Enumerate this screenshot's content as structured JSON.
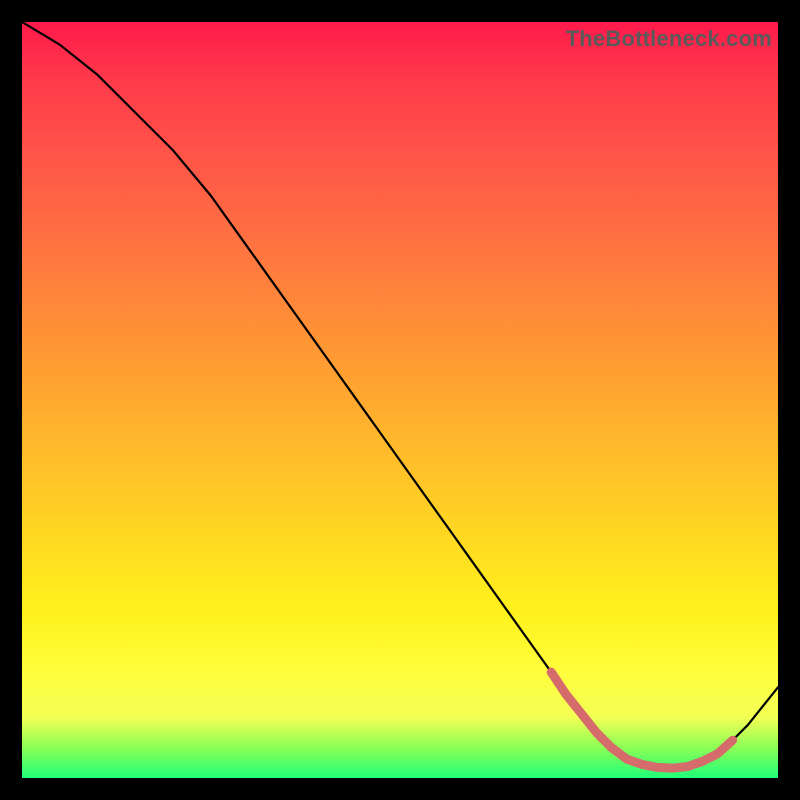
{
  "watermark": "TheBottleneck.com",
  "chart_data": {
    "type": "line",
    "title": "",
    "xlabel": "",
    "ylabel": "",
    "xlim": [
      0,
      100
    ],
    "ylim": [
      0,
      100
    ],
    "grid": false,
    "legend": false,
    "series": [
      {
        "name": "bottleneck-curve",
        "color": "#000000",
        "x": [
          0,
          5,
          10,
          15,
          20,
          25,
          30,
          35,
          40,
          45,
          50,
          55,
          60,
          65,
          70,
          72,
          75,
          78,
          80,
          83,
          86,
          88,
          90,
          93,
          96,
          100
        ],
        "y": [
          100,
          97,
          93,
          88,
          83,
          77,
          70,
          63,
          56,
          49,
          42,
          35,
          28,
          21,
          14,
          11,
          7,
          4,
          2.5,
          1.5,
          1.3,
          1.5,
          2.2,
          4,
          7,
          12
        ]
      },
      {
        "name": "fit-highlight",
        "color": "#d66b6b",
        "x": [
          70,
          72,
          74,
          76,
          78,
          80,
          82,
          84,
          86,
          88,
          90,
          92,
          94
        ],
        "y": [
          14,
          11,
          8.5,
          6,
          4,
          2.5,
          1.8,
          1.4,
          1.3,
          1.5,
          2.2,
          3.2,
          5
        ]
      }
    ]
  }
}
